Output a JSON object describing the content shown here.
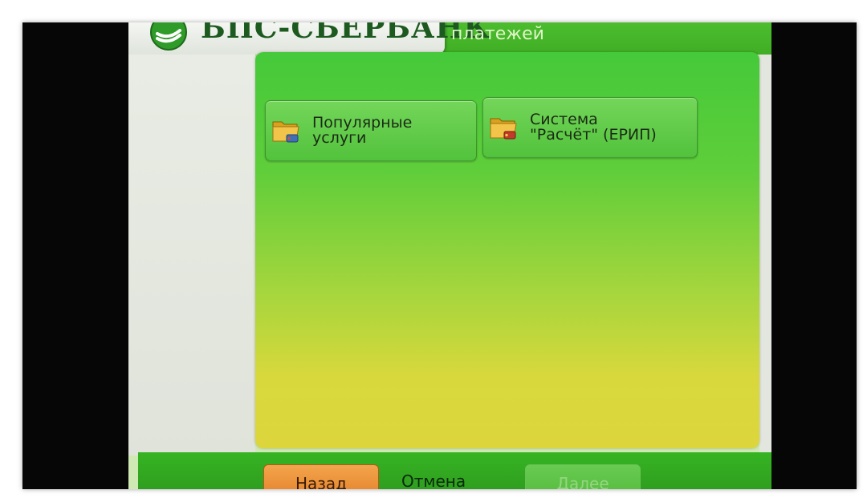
{
  "header": {
    "bank_name": "БПС-СБЕРБАНК",
    "title": "платежей",
    "logo_icon": "bank-logo-icon",
    "brand_color": "#1d5a20"
  },
  "menu": {
    "tiles": [
      {
        "label": "Популярные\nуслуги",
        "icon": "folder-icon"
      },
      {
        "label": "Система\n\"Расчёт\" (ЕРИП)",
        "icon": "folder-icon"
      }
    ]
  },
  "footer": {
    "back_label": "Назад",
    "cancel_label": "Отмена",
    "next_label": "Далее"
  },
  "colors": {
    "accent_green": "#45c93a",
    "accent_yellow": "#dcd63c",
    "back_button": "#e4822b"
  }
}
